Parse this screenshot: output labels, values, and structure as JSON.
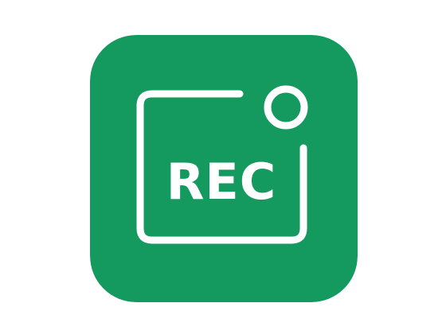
{
  "icon": {
    "name": "screen-recorder-app-icon",
    "label": "REC",
    "colors": {
      "background": "#149A5E",
      "foreground": "#FFFFFF"
    }
  }
}
